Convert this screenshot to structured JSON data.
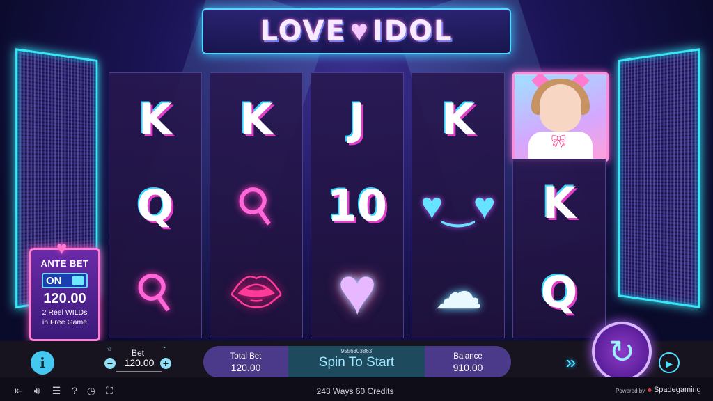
{
  "logo": {
    "word_left": "LOVE",
    "heart": "♥",
    "word_right": "IDOL"
  },
  "reels": [
    [
      "K",
      "Q",
      "wand-icon"
    ],
    [
      "K",
      "wand-icon",
      "lips-icon"
    ],
    [
      "J",
      "10",
      "ornate-heart-icon"
    ],
    [
      "K",
      "glasses-icon",
      "tail-icon"
    ],
    [
      "idol-card",
      "K",
      "Q"
    ]
  ],
  "symbols": {
    "r1c0": "K",
    "r1c1": "Q",
    "r2c0": "K",
    "r3c0": "J",
    "r3c1": "10",
    "r4c0": "K",
    "r5c1": "K",
    "r5c2": "Q"
  },
  "ante": {
    "title": "ANTE BET",
    "toggle": "ON",
    "amount": "120.00",
    "desc_line1": "2 Reel WILDs",
    "desc_line2": "in Free Game"
  },
  "bet": {
    "label": "Bet",
    "value": "120.00",
    "minus": "−",
    "plus": "+"
  },
  "panel": {
    "round_id": "9556303863",
    "total_label": "Total Bet",
    "total_value": "120.00",
    "cta": "Spin To Start",
    "balance_label": "Balance",
    "balance_value": "910.00"
  },
  "footer": {
    "ways": "243 Ways  60 Credits",
    "powered": "Powered by",
    "brand": "Spadegaming"
  },
  "colors": {
    "accent": "#38e6f5",
    "pink": "#ff6ad5",
    "spin": "#8e3cc8"
  }
}
